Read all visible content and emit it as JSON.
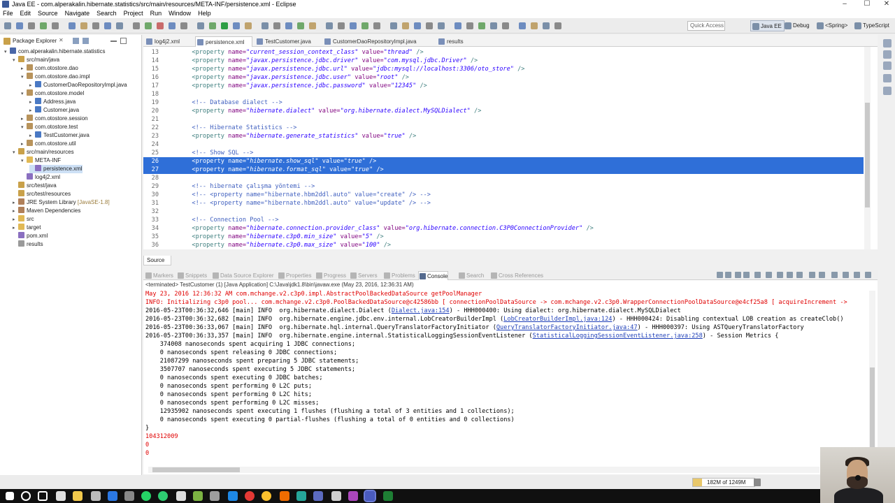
{
  "window": {
    "title": "Java EE - com.alperakalin.hibernate.statistics/src/main/resources/META-INF/persistence.xml - Eclipse",
    "minimize": "–",
    "maximize": "☐",
    "close": "✕"
  },
  "menu": [
    "File",
    "Edit",
    "Source",
    "Navigate",
    "Search",
    "Project",
    "Run",
    "Window",
    "Help"
  ],
  "toolbar": {
    "quick_access_placeholder": "Quick Access",
    "perspectives": [
      "Java EE",
      "Debug",
      "<Spring>",
      "TypeScript"
    ]
  },
  "package_explorer": {
    "tab_label": "Package Explorer",
    "tab_close": "✕",
    "rows": [
      {
        "label": "com.alperakalin.hibernate.statistics",
        "depth": 0,
        "arrow": "▾",
        "icon": "project-icon"
      },
      {
        "label": "src/main/java",
        "depth": 1,
        "arrow": "▾",
        "icon": "source-folder-icon"
      },
      {
        "label": "com.otostore.dao",
        "depth": 2,
        "arrow": "▸",
        "icon": "package-icon"
      },
      {
        "label": "com.otostore.dao.impl",
        "depth": 2,
        "arrow": "▾",
        "icon": "package-icon"
      },
      {
        "label": "CustomerDaoRepositoryImpl.java",
        "depth": 3,
        "arrow": "▸",
        "icon": "java-file-icon"
      },
      {
        "label": "com.otostore.model",
        "depth": 2,
        "arrow": "▾",
        "icon": "package-icon"
      },
      {
        "label": "Address.java",
        "depth": 3,
        "arrow": "▸",
        "icon": "java-file-icon"
      },
      {
        "label": "Customer.java",
        "depth": 3,
        "arrow": "▸",
        "icon": "java-file-icon"
      },
      {
        "label": "com.otostore.session",
        "depth": 2,
        "arrow": "▸",
        "icon": "package-icon"
      },
      {
        "label": "com.otostore.test",
        "depth": 2,
        "arrow": "▾",
        "icon": "package-icon"
      },
      {
        "label": "TestCustomer.java",
        "depth": 3,
        "arrow": "▸",
        "icon": "java-file-icon"
      },
      {
        "label": "com.otostore.util",
        "depth": 2,
        "arrow": "▸",
        "icon": "package-icon"
      },
      {
        "label": "src/main/resources",
        "depth": 1,
        "arrow": "▾",
        "icon": "source-folder-icon"
      },
      {
        "label": "META-INF",
        "depth": 2,
        "arrow": "▾",
        "icon": "folder-icon"
      },
      {
        "label": "persistence.xml",
        "depth": 3,
        "arrow": "",
        "icon": "xml-file-icon",
        "selected": true
      },
      {
        "label": "log4j2.xml",
        "depth": 2,
        "arrow": "",
        "icon": "xml-file-icon"
      },
      {
        "label": "src/test/java",
        "depth": 1,
        "arrow": "",
        "icon": "source-folder-icon"
      },
      {
        "label": "src/test/resources",
        "depth": 1,
        "arrow": "",
        "icon": "source-folder-icon"
      },
      {
        "label": "JRE System Library",
        "suffix": " [JavaSE-1.8]",
        "depth": 1,
        "arrow": "▸",
        "icon": "library-icon"
      },
      {
        "label": "Maven Dependencies",
        "depth": 1,
        "arrow": "▸",
        "icon": "library-icon"
      },
      {
        "label": "src",
        "depth": 1,
        "arrow": "▸",
        "icon": "folder-icon"
      },
      {
        "label": "target",
        "depth": 1,
        "arrow": "▸",
        "icon": "folder-icon"
      },
      {
        "label": "pom.xml",
        "depth": 1,
        "arrow": "",
        "icon": "xml-file-icon"
      },
      {
        "label": "results",
        "depth": 1,
        "arrow": "",
        "icon": "file-icon"
      }
    ]
  },
  "editor": {
    "tabs": [
      {
        "label": "log4j2.xml",
        "active": false
      },
      {
        "label": "persistence.xml",
        "active": true
      },
      {
        "label": "TestCustomer.java",
        "active": false
      },
      {
        "label": "CustomerDaoRepositoryImpl.java",
        "active": false
      },
      {
        "label": "results",
        "active": false
      }
    ],
    "source_tab": "Source",
    "lines": [
      {
        "n": "13",
        "html": "        <span class='tag'>&lt;property</span> <span class='attr'>name=</span><span class='val'>\"current_session_context_class\"</span> <span class='attr'>value=</span><span class='val'>\"thread\"</span> <span class='tag'>/&gt;</span>"
      },
      {
        "n": "14",
        "html": "        <span class='tag'>&lt;property</span> <span class='attr'>name=</span><span class='val'>\"javax.persistence.jdbc.driver\"</span> <span class='attr'>value=</span><span class='val'>\"com.mysql.jdbc.Driver\"</span> <span class='tag'>/&gt;</span>"
      },
      {
        "n": "15",
        "html": "        <span class='tag'>&lt;property</span> <span class='attr'>name=</span><span class='val'>\"javax.persistence.jdbc.url\"</span> <span class='attr'>value=</span><span class='val'>\"jdbc:mysql://localhost:3306/oto_store\"</span> <span class='tag'>/&gt;</span>"
      },
      {
        "n": "16",
        "html": "        <span class='tag'>&lt;property</span> <span class='attr'>name=</span><span class='val'>\"javax.persistence.jdbc.user\"</span> <span class='attr'>value=</span><span class='val'>\"root\"</span> <span class='tag'>/&gt;</span>"
      },
      {
        "n": "17",
        "html": "        <span class='tag'>&lt;property</span> <span class='attr'>name=</span><span class='val'>\"javax.persistence.jdbc.password\"</span> <span class='attr'>value=</span><span class='val'>\"12345\"</span> <span class='tag'>/&gt;</span>"
      },
      {
        "n": "18",
        "html": ""
      },
      {
        "n": "19",
        "html": "        <span class='cmt'>&lt;!-- Database dialect --&gt;</span>"
      },
      {
        "n": "20",
        "html": "        <span class='tag'>&lt;property</span> <span class='attr'>name=</span><span class='val'>\"hibernate.dialect\"</span> <span class='attr'>value=</span><span class='val'>\"org.hibernate.dialect.MySQLDialect\"</span> <span class='tag'>/&gt;</span>"
      },
      {
        "n": "21",
        "html": ""
      },
      {
        "n": "22",
        "html": "        <span class='cmt'>&lt;!-- Hibernate Statistics --&gt;</span>"
      },
      {
        "n": "23",
        "html": "        <span class='tag'>&lt;property</span> <span class='attr'>name=</span><span class='val'>\"hibernate.generate_statistics\"</span> <span class='attr'>value=</span><span class='val'>\"true\"</span> <span class='tag'>/&gt;</span>"
      },
      {
        "n": "24",
        "html": ""
      },
      {
        "n": "25",
        "html": "        <span class='cmt'>&lt;!-- Show SQL --&gt;</span>"
      },
      {
        "n": "26",
        "html": "        <span class='tag'>&lt;property</span> <span class='attr'>name=</span><span class='val'>\"hibernate.show_sql\"</span> <span class='attr'>value=</span><span class='val'>\"true\"</span> <span class='tag'>/&gt;</span>",
        "selected": true
      },
      {
        "n": "27",
        "html": "        <span class='tag'>&lt;property</span> <span class='attr'>name=</span><span class='val'>\"hibernate.format_sql\"</span> <span class='attr'>value=</span><span class='val'>\"true\"</span> <span class='tag'>/&gt;</span>",
        "selected": true
      },
      {
        "n": "28",
        "html": ""
      },
      {
        "n": "29",
        "html": "        <span class='cmt'>&lt;!-- hibernate çalışma yöntemi --&gt;</span>"
      },
      {
        "n": "30",
        "html": "        <span class='cmt'>&lt;!-- &lt;property name=\"hibernate.hbm2ddl.auto\" value=\"create\" /&gt; --&gt;</span>"
      },
      {
        "n": "31",
        "html": "        <span class='cmt'>&lt;!-- &lt;property name=\"hibernate.hbm2ddl.auto\" value=\"update\" /&gt; --&gt;</span>"
      },
      {
        "n": "32",
        "html": ""
      },
      {
        "n": "33",
        "html": "        <span class='cmt'>&lt;!-- Connection Pool --&gt;</span>"
      },
      {
        "n": "34",
        "html": "        <span class='tag'>&lt;property</span> <span class='attr'>name=</span><span class='val'>\"hibernate.connection.provider_class\"</span> <span class='attr'>value=</span><span class='val'>\"org.hibernate.connection.C3P0ConnectionProvider\"</span> <span class='tag'>/&gt;</span>"
      },
      {
        "n": "35",
        "html": "        <span class='tag'>&lt;property</span> <span class='attr'>name=</span><span class='val'>\"hibernate.c3p0.min_size\"</span> <span class='attr'>value=</span><span class='val'>\"5\"</span> <span class='tag'>/&gt;</span>"
      },
      {
        "n": "36",
        "html": "        <span class='tag'>&lt;property</span> <span class='attr'>name=</span><span class='val'>\"hibernate.c3p0.max_size\"</span> <span class='attr'>value=</span><span class='val'>\"100\"</span> <span class='tag'>/&gt;</span>"
      }
    ]
  },
  "bottom_panel": {
    "tabs": [
      {
        "label": "Markers",
        "active": false
      },
      {
        "label": "Snippets",
        "active": false
      },
      {
        "label": "Data Source Explorer",
        "active": false
      },
      {
        "label": "Properties",
        "active": false
      },
      {
        "label": "Progress",
        "active": false
      },
      {
        "label": "Servers",
        "active": false
      },
      {
        "label": "Problems",
        "active": false
      },
      {
        "label": "Console",
        "active": true
      },
      {
        "label": "Search",
        "active": false
      },
      {
        "label": "Cross References",
        "active": false
      }
    ],
    "terminated": "<terminated> TestCustomer (1) [Java Application] C:\\Java\\jdk1.8\\bin\\javaw.exe (May 23, 2016, 12:36:31 AM)",
    "console_lines": [
      {
        "text": "May 23, 2016 12:36:32 AM com.mchange.v2.c3p0.impl.AbstractPoolBackedDataSource getPoolManager",
        "err": true
      },
      {
        "text": "INFO: Initializing c3p0 pool... com.mchange.v2.c3p0.PoolBackedDataSource@c42586bb [ connectionPoolDataSource -> com.mchange.v2.c3p0.WrapperConnectionPoolDataSource@e4cf25a8 [ acquireIncrement ->",
        "err": true
      },
      {
        "text": "2016-05-23T00:36:32,646 [main] INFO  org.hibernate.dialect.Dialect (",
        "link": "Dialect.java:154",
        "tail": ") - HHH000400: Using dialect: org.hibernate.dialect.MySQLDialect"
      },
      {
        "text": "2016-05-23T00:36:32,682 [main] INFO  org.hibernate.engine.jdbc.env.internal.LobCreatorBuilderImpl (",
        "link": "LobCreatorBuilderImpl.java:124",
        "tail": ") - HHH000424: Disabling contextual LOB creation as createClob()"
      },
      {
        "text": "2016-05-23T00:36:33,067 [main] INFO  org.hibernate.hql.internal.QueryTranslatorFactoryInitiator (",
        "link": "QueryTranslatorFactoryInitiator.java:47",
        "tail": ") - HHH000397: Using ASTQueryTranslatorFactory"
      },
      {
        "text": "2016-05-23T00:36:33,357 [main] INFO  org.hibernate.engine.internal.StatisticalLoggingSessionEventListener (",
        "link": "StatisticalLoggingSessionEventListener.java:258",
        "tail": ") - Session Metrics {"
      },
      {
        "text": "    374008 nanoseconds spent acquiring 1 JDBC connections;"
      },
      {
        "text": "    0 nanoseconds spent releasing 0 JDBC connections;"
      },
      {
        "text": "    21087299 nanoseconds spent preparing 5 JDBC statements;"
      },
      {
        "text": "    3507707 nanoseconds spent executing 5 JDBC statements;"
      },
      {
        "text": "    0 nanoseconds spent executing 0 JDBC batches;"
      },
      {
        "text": "    0 nanoseconds spent performing 0 L2C puts;"
      },
      {
        "text": "    0 nanoseconds spent performing 0 L2C hits;"
      },
      {
        "text": "    0 nanoseconds spent performing 0 L2C misses;"
      },
      {
        "text": "    12935902 nanoseconds spent executing 1 flushes (flushing a total of 3 entities and 1 collections);"
      },
      {
        "text": "    0 nanoseconds spent executing 0 partial-flushes (flushing a total of 0 entities and 0 collections)"
      },
      {
        "text": "}"
      },
      {
        "text": "104312009",
        "err": true
      },
      {
        "text": "0",
        "err": true
      },
      {
        "text": "0",
        "err": true
      }
    ]
  },
  "status": {
    "heap_text": "182M of 1249M",
    "heap_fraction": 0.146
  }
}
